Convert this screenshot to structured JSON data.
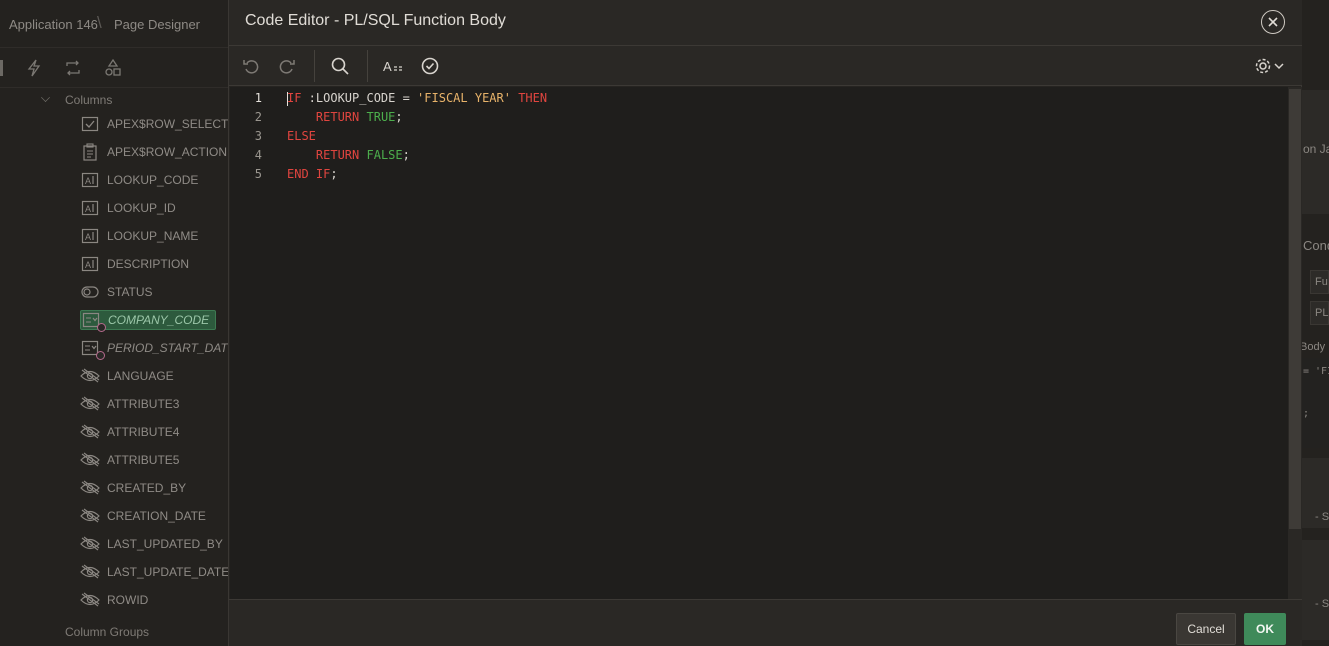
{
  "breadcrumb": {
    "app": "Application 146",
    "page": "Page Designer"
  },
  "tree": {
    "section_label": "Columns",
    "footer_label": "Column Groups",
    "items": [
      {
        "label": "APEX$ROW_SELECTOR",
        "icon": "checkbox-icon"
      },
      {
        "label": "APEX$ROW_ACTION",
        "icon": "clipboard-icon"
      },
      {
        "label": "LOOKUP_CODE",
        "icon": "text-field-icon"
      },
      {
        "label": "LOOKUP_ID",
        "icon": "text-field-icon"
      },
      {
        "label": "LOOKUP_NAME",
        "icon": "text-field-icon"
      },
      {
        "label": "DESCRIPTION",
        "icon": "text-field-icon"
      },
      {
        "label": "STATUS",
        "icon": "toggle-icon"
      },
      {
        "label": "COMPANY_CODE",
        "icon": "select-list-icon",
        "selected": true
      },
      {
        "label": "PERIOD_START_DATE",
        "icon": "select-list-icon"
      },
      {
        "label": "LANGUAGE",
        "icon": "hidden-eye-icon"
      },
      {
        "label": "ATTRIBUTE3",
        "icon": "hidden-eye-icon"
      },
      {
        "label": "ATTRIBUTE4",
        "icon": "hidden-eye-icon"
      },
      {
        "label": "ATTRIBUTE5",
        "icon": "hidden-eye-icon"
      },
      {
        "label": "CREATED_BY",
        "icon": "hidden-eye-icon"
      },
      {
        "label": "CREATION_DATE",
        "icon": "hidden-eye-icon"
      },
      {
        "label": "LAST_UPDATED_BY",
        "icon": "hidden-eye-icon"
      },
      {
        "label": "LAST_UPDATE_DATE",
        "icon": "hidden-eye-icon"
      },
      {
        "label": "ROWID",
        "icon": "hidden-eye-icon"
      }
    ]
  },
  "right_panel": {
    "frag_1": "on Jav",
    "frag_2": "Cond",
    "frag_3": "Fu",
    "frag_4": "PL",
    "frag_5": "Body",
    "frag_6": "= 'FI",
    "frag_7": ";",
    "frag_8": "- S",
    "frag_9": "- S"
  },
  "dialog": {
    "title": "Code Editor - PL/SQL Function Body",
    "cancel_label": "Cancel",
    "ok_label": "OK",
    "toolbar": {
      "undo_icon": "undo-icon",
      "redo_icon": "redo-icon",
      "search_icon": "search-icon",
      "autocomplete_icon": "autocomplete-icon",
      "validate_icon": "validate-check-icon",
      "settings_icon": "gear-icon"
    },
    "code": {
      "line_numbers": [
        "1",
        "2",
        "3",
        "4",
        "5"
      ],
      "lines": [
        {
          "t1": "IF",
          "t2": " :LOOKUP_CODE = ",
          "t3": "'FISCAL YEAR'",
          "t4": " ",
          "t5": "THEN"
        },
        {
          "indent": "    ",
          "k": "RETURN",
          "sp": " ",
          "b": "TRUE",
          "end": ";"
        },
        {
          "k": "ELSE"
        },
        {
          "indent": "    ",
          "k": "RETURN",
          "sp": " ",
          "b": "FALSE",
          "end": ";"
        },
        {
          "k1": "END",
          "sp": " ",
          "k2": "IF",
          "end": ";"
        }
      ]
    }
  },
  "colors": {
    "keyword": "#e0453f",
    "boolean": "#4cae4c",
    "string": "#e8b36a",
    "ok_button": "#3f8a5a"
  }
}
